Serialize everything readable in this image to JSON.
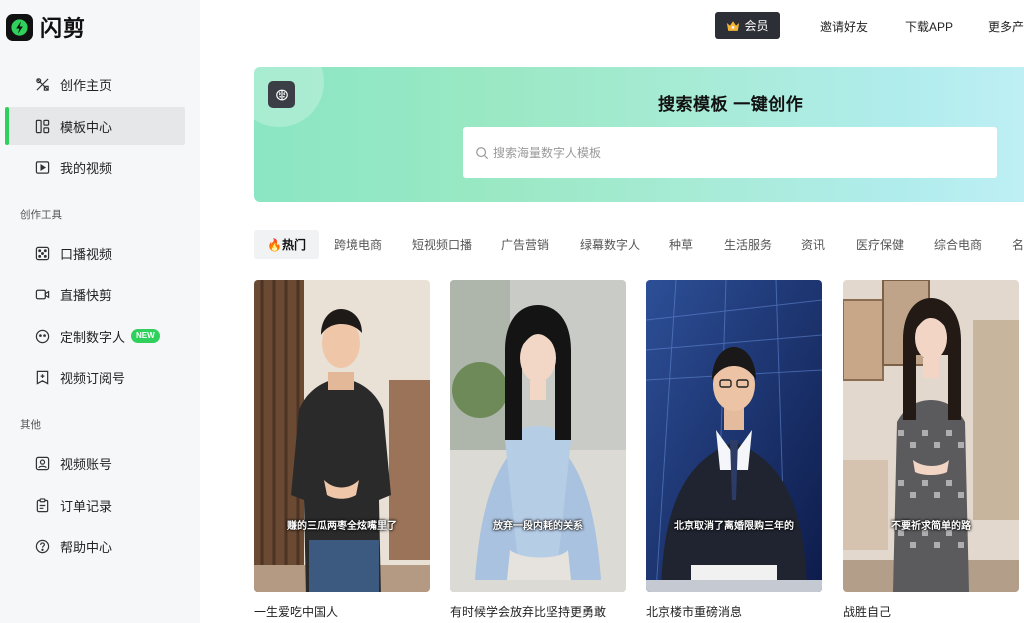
{
  "app": {
    "name": "闪剪"
  },
  "sidebar": {
    "main_items": [
      {
        "label": "创作主页",
        "icon": "tools-icon"
      },
      {
        "label": "模板中心",
        "icon": "template-icon"
      },
      {
        "label": "我的视频",
        "icon": "video-icon"
      }
    ],
    "section_creation": "创作工具",
    "creation_items": [
      {
        "label": "口播视频",
        "icon": "dice-icon"
      },
      {
        "label": "直播快剪",
        "icon": "camera-icon"
      },
      {
        "label": "定制数字人",
        "icon": "smiley-icon",
        "badge": "NEW"
      },
      {
        "label": "视频订阅号",
        "icon": "bookmark-plus-icon"
      }
    ],
    "section_other": "其他",
    "other_items": [
      {
        "label": "视频账号",
        "icon": "account-icon"
      },
      {
        "label": "订单记录",
        "icon": "clipboard-icon"
      },
      {
        "label": "帮助中心",
        "icon": "help-icon"
      }
    ],
    "active_index": 1
  },
  "topnav": {
    "vip_label": "会员",
    "invite": "邀请好友",
    "download": "下载APP",
    "more": "更多产"
  },
  "banner": {
    "title": "搜索模板 一键创作",
    "search_placeholder": "搜索海量数字人模板"
  },
  "tabs": [
    {
      "label": "🔥热门",
      "active": true
    },
    {
      "label": "跨境电商"
    },
    {
      "label": "短视频口播"
    },
    {
      "label": "广告营销"
    },
    {
      "label": "绿幕数字人"
    },
    {
      "label": "种草"
    },
    {
      "label": "生活服务"
    },
    {
      "label": "资讯"
    },
    {
      "label": "医疗保健"
    },
    {
      "label": "综合电商"
    },
    {
      "label": "名"
    }
  ],
  "cards": [
    {
      "subtitle": "赚的三瓜两枣全炫嘴里了",
      "title": "一生爱吃中国人"
    },
    {
      "subtitle": "放弃一段内耗的关系",
      "title": "有时候学会放弃比坚持更勇敢"
    },
    {
      "subtitle": "北京取消了离婚限购三年的",
      "title": "北京楼市重磅消息"
    },
    {
      "subtitle": "不要祈求简单的路",
      "title": "战胜自己"
    }
  ],
  "colors": {
    "accent_green": "#2fd05c",
    "sidebar_bg": "#f6f7f8",
    "vip_bg": "#2c2f36"
  }
}
